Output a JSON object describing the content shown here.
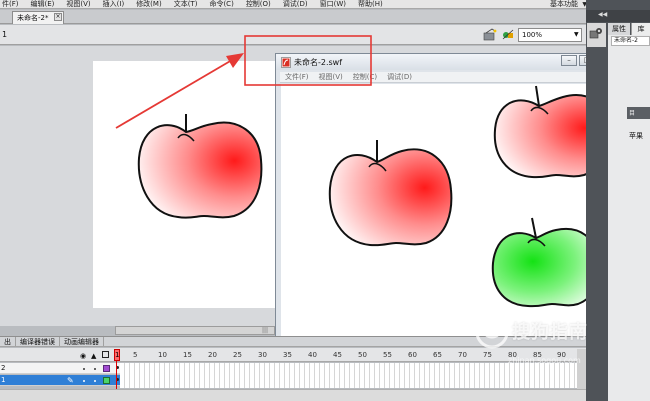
{
  "menu": {
    "items": [
      "件(F)",
      "编辑(E)",
      "视图(V)",
      "插入(I)",
      "修改(M)",
      "文本(T)",
      "命令(C)",
      "控制(O)",
      "调试(D)",
      "窗口(W)",
      "帮助(H)"
    ],
    "workspace": "基本功能"
  },
  "document": {
    "tab_label": "未命名-2*",
    "scene_label": "1",
    "zoom": "100%"
  },
  "swf_window": {
    "title": "未命名-2.swf",
    "menu": [
      "文件(F)",
      "视图(V)",
      "控制(C)",
      "调试(D)"
    ]
  },
  "right_panel": {
    "tab_properties": "属性",
    "tab_library": "库",
    "library_document": "未命名-2",
    "library_item": "苹果",
    "band_label": "目"
  },
  "timeline": {
    "tabs": [
      "出",
      "编译器错误",
      "动画编辑器"
    ],
    "frame_numbers": [
      "1",
      "5",
      "10",
      "15",
      "20",
      "25",
      "30",
      "35",
      "40",
      "45",
      "50",
      "55",
      "60",
      "65",
      "70",
      "75",
      "80",
      "85",
      "90"
    ],
    "layers": [
      {
        "name": "2",
        "selected": false,
        "color": "#a24bd1"
      },
      {
        "name": "1",
        "selected": true,
        "color": "#4ad56a"
      }
    ]
  },
  "watermark": {
    "text": "搜狗指南",
    "url": "zhinan.sogou.com"
  },
  "colors": {
    "highlight": "#e53935",
    "apple_red": "#ff1a1a",
    "apple_green": "#14e214",
    "selected_layer": "#2f7fd6"
  }
}
